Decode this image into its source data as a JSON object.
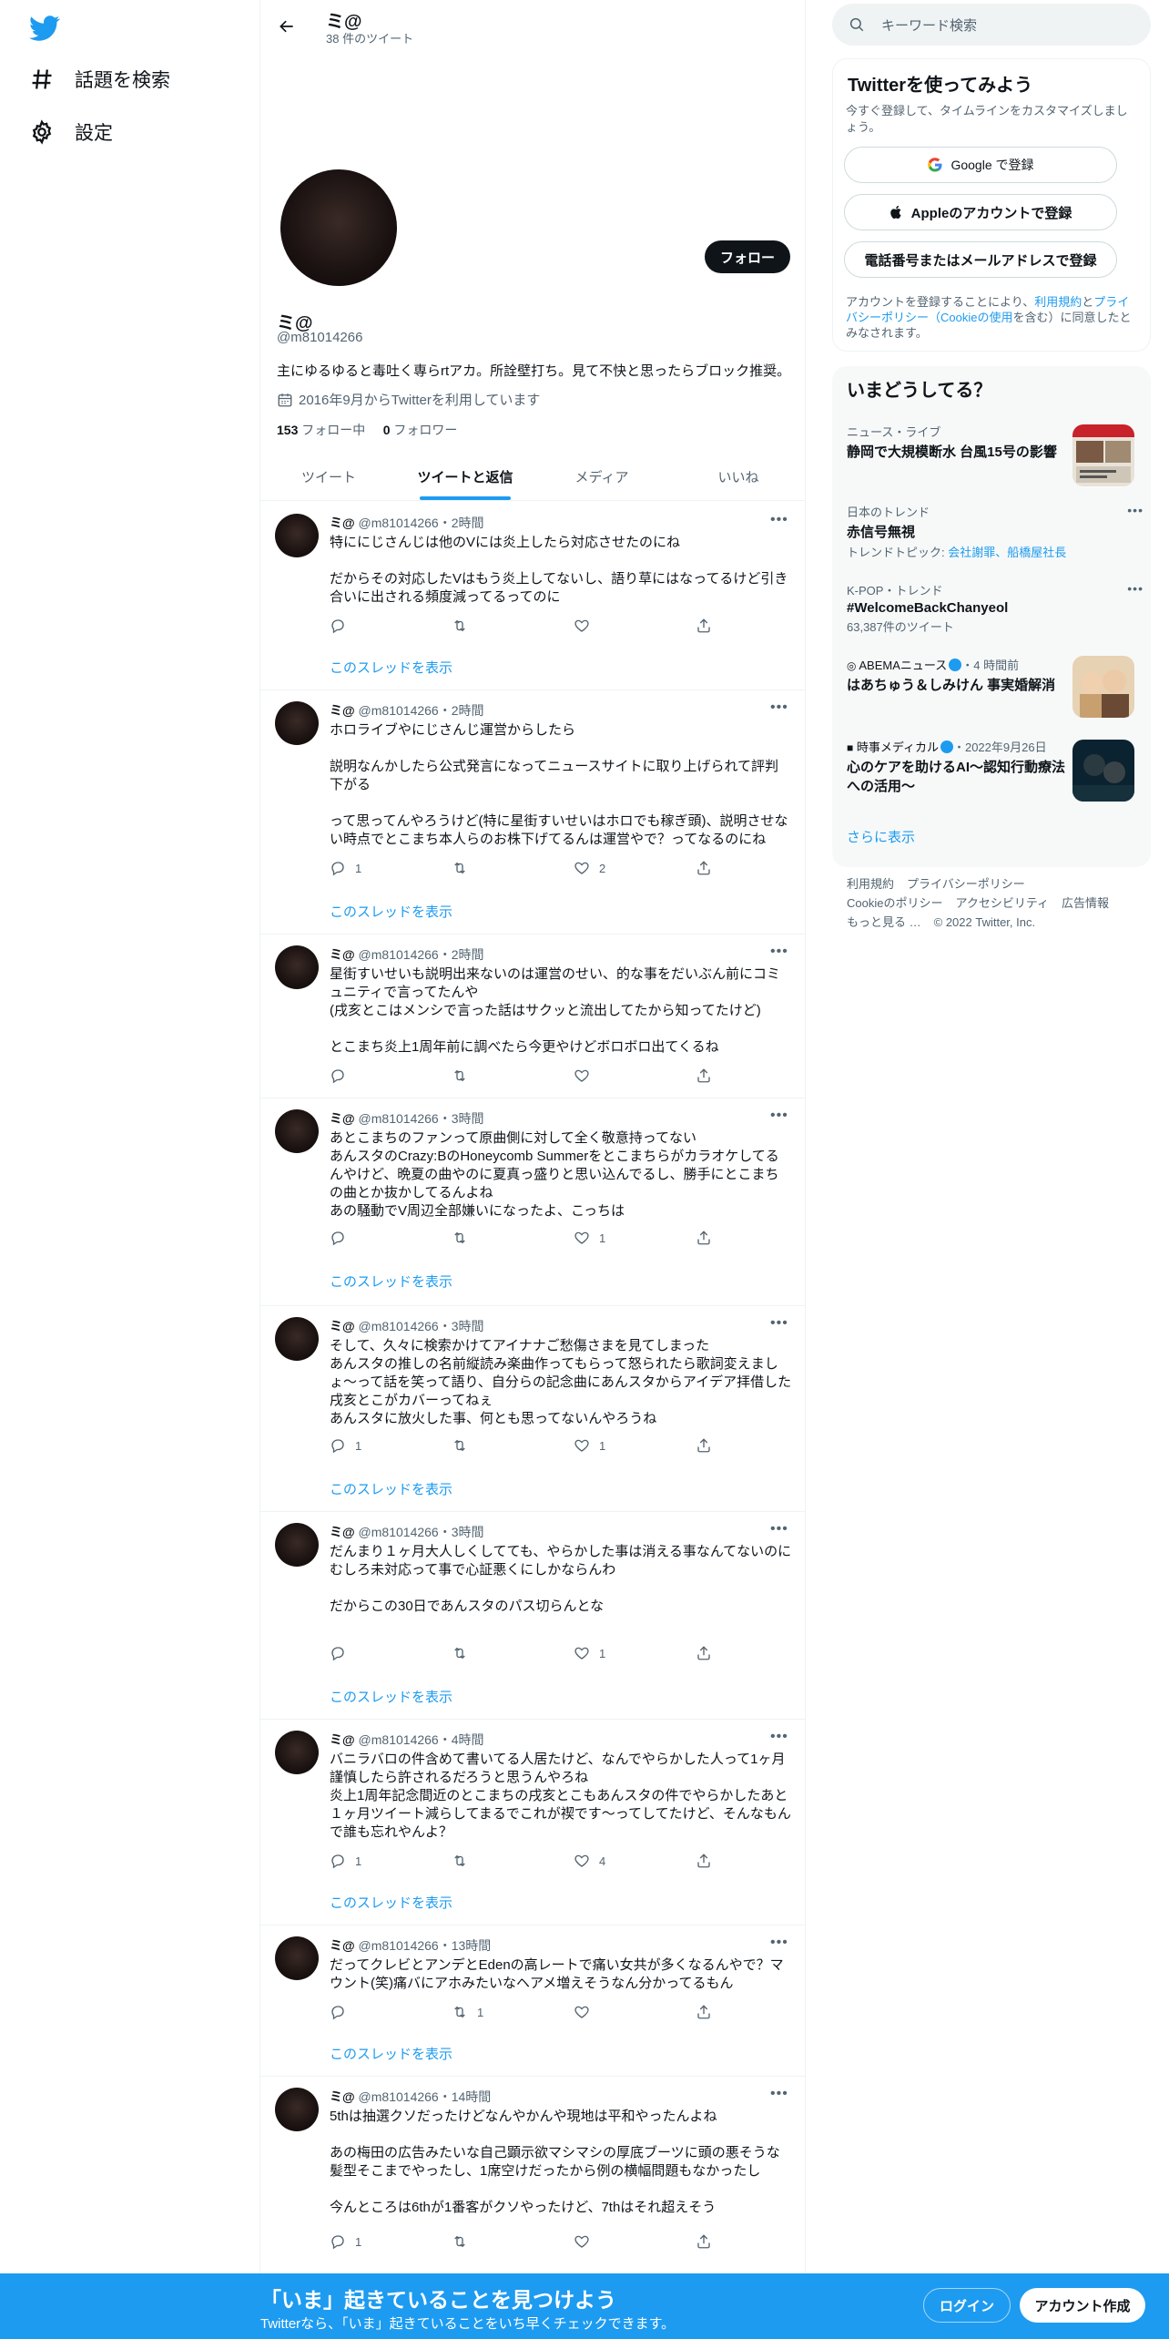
{
  "nav": {
    "items": [
      {
        "label": "話題を検索",
        "icon": "hashtag-icon"
      },
      {
        "label": "設定",
        "icon": "gear-icon"
      }
    ]
  },
  "topbar": {
    "name": "ミ@",
    "tweet_count": "38 件のツイート"
  },
  "profile": {
    "name": "ミ@",
    "handle": "@m81014266",
    "bio": "主にゆるゆると毒吐く専らrtアカ。所詮壁打ち。見て不快と思ったらブロック推奨。",
    "joined": "2016年9月からTwitterを利用しています",
    "following_count": "153",
    "following_label": "フォロー中",
    "followers_count": "0",
    "followers_label": "フォロワー",
    "follow_button": "フォロー"
  },
  "tabs": [
    "ツイート",
    "ツイートと返信",
    "メディア",
    "いいね"
  ],
  "active_tab": "ツイートと返信",
  "thread_link_label": "このスレッドを表示",
  "tweets": [
    {
      "name": "ミ@",
      "handle": "@m81014266",
      "time": "2時間",
      "text": "特ににじさんじは他のVには炎上したら対応させたのにね\n\nだからその対応したVはもう炎上してないし、語り草にはなってるけど引き合いに出される頻度減ってるってのに",
      "replies": "",
      "retweets": "",
      "likes": "",
      "thread": true
    },
    {
      "name": "ミ@",
      "handle": "@m81014266",
      "time": "2時間",
      "text": "ホロライブやにじさんじ運営からしたら\n\n説明なんかしたら公式発言になってニュースサイトに取り上げられて評判下がる\n\nって思ってんやろうけど(特に星街すいせいはホロでも稼ぎ頭)、説明させない時点でとこまち本人らのお株下げてるんは運営やで？ってなるのにね",
      "replies": "1",
      "retweets": "",
      "likes": "2",
      "thread": true
    },
    {
      "name": "ミ@",
      "handle": "@m81014266",
      "time": "2時間",
      "text": "星街すいせいも説明出来ないのは運営のせい、的な事をだいぶん前にコミュニティで言ってたんや\n(戌亥とこはメンシで言った話はサクッと流出してたから知ってたけど)\n\nとこまち炎上1周年前に調べたら今更やけどボロボロ出てくるね",
      "replies": "",
      "retweets": "",
      "likes": "",
      "thread": false
    },
    {
      "name": "ミ@",
      "handle": "@m81014266",
      "time": "3時間",
      "text": "あとこまちのファンって原曲側に対して全く敬意持ってない\nあんスタのCrazy:BのHoneycomb Summerをとこまちらがカラオケしてるんやけど、晩夏の曲やのに夏真っ盛りと思い込んでるし、勝手にとこまちの曲とか抜かしてるんよね\nあの騒動でV周辺全部嫌いになったよ、こっちは",
      "replies": "",
      "retweets": "",
      "likes": "1",
      "thread": true
    },
    {
      "name": "ミ@",
      "handle": "@m81014266",
      "time": "3時間",
      "text": "そして、久々に検索かけてアイナナご愁傷さまを見てしまった\nあんスタの推しの名前縦読み楽曲作ってもらって怒られたら歌詞変えましょ〜って話を笑って語り、自分らの記念曲にあんスタからアイデア拝借した戌亥とこがカバーってねぇ\nあんスタに放火した事、何とも思ってないんやろうね",
      "replies": "1",
      "retweets": "",
      "likes": "1",
      "thread": true
    },
    {
      "name": "ミ@",
      "handle": "@m81014266",
      "time": "3時間",
      "text": "だんまり１ヶ月大人しくしてても、やらかした事は消える事なんてないのに\nむしろ未対応って事で心証悪くにしかならんわ\n\nだからこの30日であんスタのパス切らんとな",
      "replies": "",
      "retweets": "",
      "likes": "1",
      "thread": true
    },
    {
      "name": "ミ@",
      "handle": "@m81014266",
      "time": "4時間",
      "text": "バニラバロの件含めて書いてる人居たけど、なんでやらかした人って1ヶ月謹慎したら許されるだろうと思うんやろね\n炎上1周年記念間近のとこまちの戌亥とこもあんスタの件でやらかしたあと１ヶ月ツイート減らしてまるでこれが禊です〜ってしてたけど、そんなもんで誰も忘れやんよ？",
      "replies": "1",
      "retweets": "",
      "likes": "4",
      "thread": true
    },
    {
      "name": "ミ@",
      "handle": "@m81014266",
      "time": "13時間",
      "text": "だってクレビとアンデとEdenの高レートで痛い女共が多くなるんやで？マウント(笑)痛バにアホみたいなヘアメ増えそうなん分かってるもん",
      "replies": "",
      "retweets": "1",
      "likes": "",
      "thread": true
    },
    {
      "name": "ミ@",
      "handle": "@m81014266",
      "time": "14時間",
      "text": "5thは抽選クソだったけどなんやかんや現地は平和やったんよね\n\nあの梅田の広告みたいな自己顕示欲マシマシの厚底ブーツに頭の悪そうな髪型そこまでやったし、1席空けだったから例の横幅問題もなかったし\n\n今んところは6thが1番客がクソやったけど、7thはそれ超えそう",
      "replies": "1",
      "retweets": "",
      "likes": "",
      "thread": false
    }
  ],
  "right": {
    "search_placeholder": "キーワード検索",
    "signup": {
      "title": "Twitterを使ってみよう",
      "subtitle": "今すぐ登録して、タイムラインをカスタマイズしましょう。",
      "google_button": "Google で登録",
      "apple_button": "Appleのアカウントで登録",
      "phone_button": "電話番号またはメールアドレスで登録",
      "terms_pre": "アカウントを登録することにより、",
      "terms_link1": "利用規約",
      "terms_mid": "と",
      "terms_link2": "プライバシーポリシー（Cookieの使用",
      "terms_post": "を含む）に同意したとみなされます。"
    },
    "trends_title": "いまどうしてる？",
    "trends": [
      {
        "context": "ニュース・ライブ",
        "name": "静岡で大規模断水 台風15号の影響",
        "sub": "",
        "has_thumb": true
      },
      {
        "context": "日本のトレンド",
        "name": "赤信号無視",
        "sub_pre": "トレンドトピック: ",
        "sub": "会社謝罪、船橋屋社長",
        "has_thumb": false
      },
      {
        "context": "K-POP・トレンド",
        "name": "#WelcomeBackChanyeol",
        "sub": "63,387件のツイート",
        "has_thumb": false
      },
      {
        "context": "ABEMAニュース",
        "time": "・4 時間前",
        "name": "はあちゅう＆しみけん 事実婚解消",
        "sub": "",
        "has_thumb": true
      },
      {
        "context": "時事メディカル",
        "time": "・2022年9月26日",
        "name": "心のケアを助けるAI～認知行動療法への活用～",
        "sub": "",
        "has_thumb": true
      }
    ],
    "show_more": "さらに表示",
    "footer": [
      "利用規約",
      "プライバシーポリシー",
      "Cookieのポリシー",
      "アクセシビリティ",
      "広告情報",
      "もっと見る …",
      "© 2022 Twitter, Inc."
    ]
  },
  "banner": {
    "title": "「いま」起きていることを見つけよう",
    "subtitle": "Twitterなら、「いま」起きていることをいち早くチェックできます。",
    "login": "ログイン",
    "signup": "アカウント作成"
  },
  "colors": {
    "accent": "#1d9bf0",
    "banner": "#1d9bf0",
    "text": "#0f1419",
    "secondary": "#536471"
  }
}
